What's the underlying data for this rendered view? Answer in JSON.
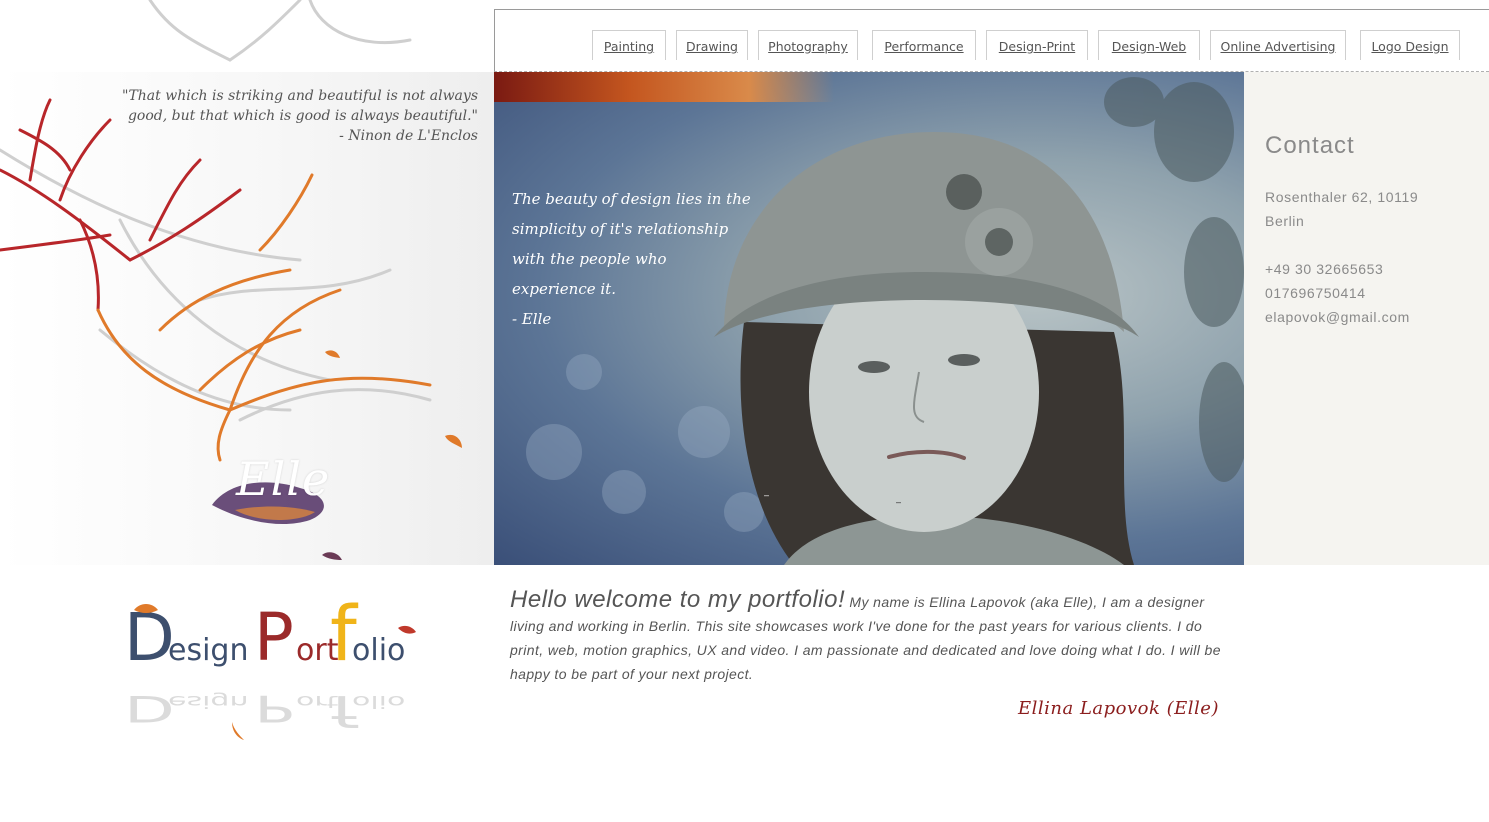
{
  "nav": {
    "items": [
      {
        "label": "Painting"
      },
      {
        "label": "Drawing"
      },
      {
        "label": "Photography"
      },
      {
        "label": "Performance"
      },
      {
        "label": "Design-Print"
      },
      {
        "label": "Design-Web"
      },
      {
        "label": "Online Advertising"
      },
      {
        "label": "Logo Design"
      }
    ]
  },
  "left_quote": {
    "text": "\"That which is striking and beautiful is not always good, but that which is good is always beautiful.\"",
    "author": "- Ninon de L'Enclos"
  },
  "elle_sign": "Elle",
  "hero": {
    "quote_lines": [
      "The beauty of design lies in the",
      "simplicity of it's relationship",
      "with the people who",
      "experience it."
    ],
    "quote_author": "- Elle",
    "marks": [
      "–",
      "–"
    ]
  },
  "contact": {
    "title": "Contact",
    "address_line1": "Rosenthaler 62, 10119",
    "address_line2": "Berlin",
    "phone1": "+49 30 32665653",
    "phone2": "017696750414",
    "email": "elapovok@gmail.com"
  },
  "logo": {
    "word1_initial": "D",
    "word1_rest": "esign",
    "word2_initial": "P",
    "word2_mid": "ort",
    "word2_f": "f",
    "word2_rest": "olio"
  },
  "welcome": {
    "heading": "Hello welcome to my portfolio!",
    "body": "My name is Ellina Lapovok (aka Elle), I am a designer living and working in Berlin. This site showcases work I've done for the past years for various clients. I do print,  web, motion graphics, UX and video. I am passionate and dedicated and love doing what I do. I will be happy to be part of your next project.",
    "signature": "Ellina Lapovok (Elle)"
  },
  "colors": {
    "tree_red": "#b8262a",
    "tree_orange": "#e07a2a",
    "logo_navy": "#3d4f6e",
    "logo_red": "#9b2a2a",
    "logo_yellow": "#f0b419",
    "signature": "#8b1d1d"
  }
}
